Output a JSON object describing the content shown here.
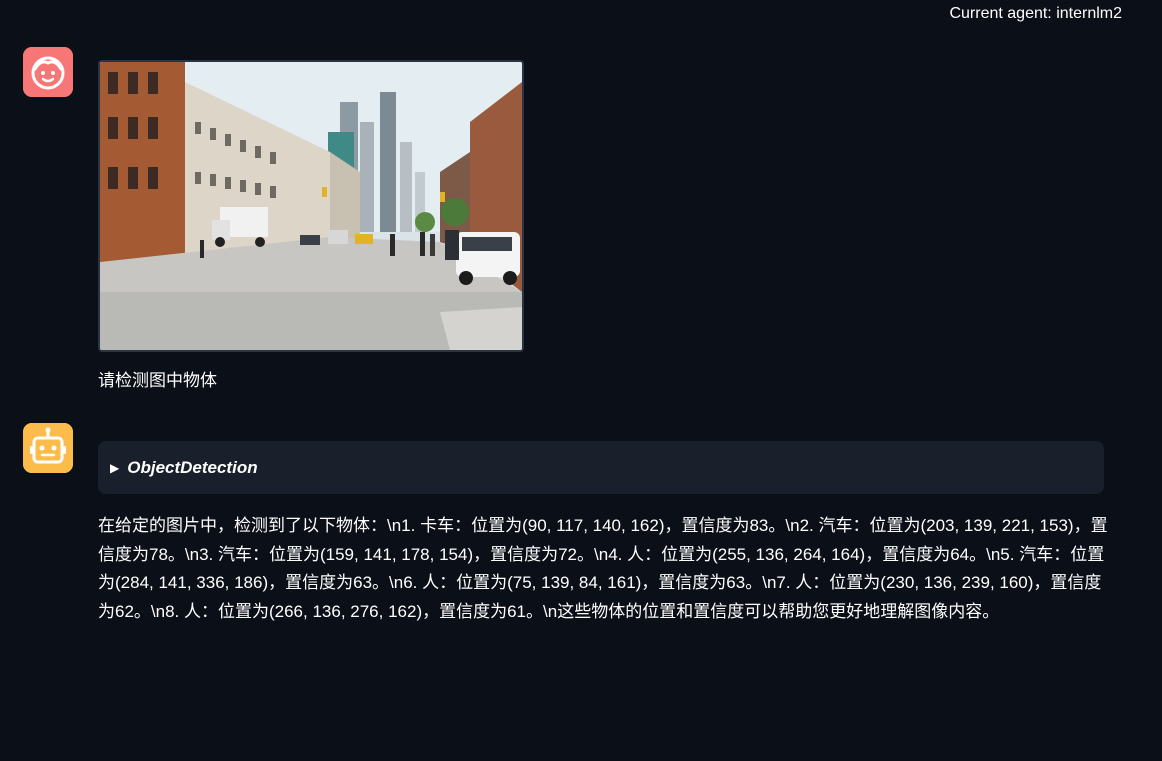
{
  "header": {
    "agent_label": "Current agent: internlm2"
  },
  "chat": {
    "user_message": "请检测图中物体",
    "tool_call": {
      "name": "ObjectDetection",
      "expanded": false
    },
    "bot_message": "在给定的图片中，检测到了以下物体：\\n1. 卡车：位置为(90, 117, 140, 162)，置信度为83。\\n2. 汽车：位置为(203, 139, 221, 153)，置信度为78。\\n3. 汽车：位置为(159, 141, 178, 154)，置信度为72。\\n4. 人：位置为(255, 136, 264, 164)，置信度为64。\\n5. 汽车：位置为(284, 141, 336, 186)，置信度为63。\\n6. 人：位置为(75, 139, 84, 161)，置信度为63。\\n7. 人：位置为(230, 136, 239, 160)，置信度为62。\\n8. 人：位置为(266, 136, 276, 162)，置信度为61。\\n这些物体的位置和置信度可以帮助您更好地理解图像内容。"
  },
  "icons": {
    "user_avatar": "user-face-icon",
    "bot_avatar": "robot-face-icon",
    "toggle": "triangle-right-icon"
  },
  "colors": {
    "background": "#0b0f18",
    "user_avatar_bg": "#f77676",
    "bot_avatar_bg": "#fbbc4b",
    "tool_card_bg": "#1a202b"
  }
}
